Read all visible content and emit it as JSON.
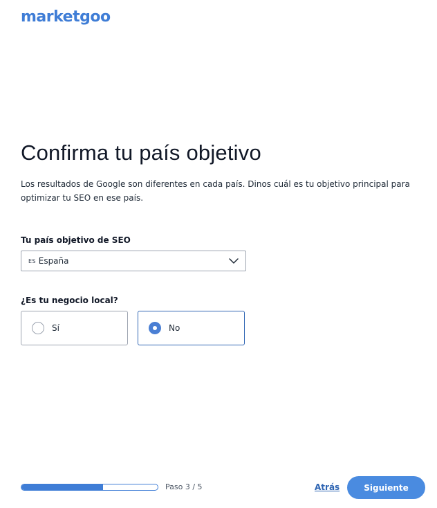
{
  "brand": {
    "logo_text": "marketgoo",
    "accent_color": "#3f7dd6"
  },
  "main": {
    "title": "Confirma tu país objetivo",
    "subtitle": "Los resultados de Google son diferentes en cada país. Dinos cuál es tu objetivo principal para optimizar tu SEO en ese país."
  },
  "country_field": {
    "label": "Tu país objetivo de SEO",
    "flag_code": "ES",
    "selected_value": "España",
    "icon": "chevron-down-icon"
  },
  "local_business": {
    "label": "¿Es tu negocio local?",
    "options": [
      {
        "label": "Sí",
        "selected": false
      },
      {
        "label": "No",
        "selected": true
      }
    ]
  },
  "footer": {
    "progress_fraction": 0.6,
    "step_text": "Paso 3 / 5",
    "back_label": "Atrás",
    "next_label": "Siguiente"
  }
}
